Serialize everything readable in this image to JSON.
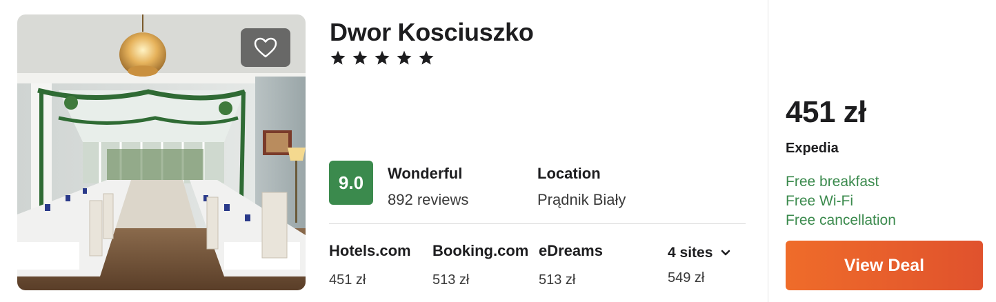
{
  "hotel": {
    "name": "Dwor Kosciuszko",
    "stars": 5
  },
  "rating": {
    "score": "9.0",
    "label": "Wonderful",
    "reviews": "892 reviews",
    "badge_color": "#3b8a4d"
  },
  "location": {
    "label": "Location",
    "value": "Prądnik Biały"
  },
  "sites": [
    {
      "name": "Hotels.com",
      "price": "451 zł"
    },
    {
      "name": "Booking.com",
      "price": "513 zł"
    },
    {
      "name": "eDreams",
      "price": "513 zł"
    }
  ],
  "more_sites": {
    "label": "4 sites",
    "price": "549 zł",
    "icon": "chevron-down-icon"
  },
  "deal": {
    "price": "451 zł",
    "provider": "Expedia",
    "perks": [
      "Free breakfast",
      "Free Wi-Fi",
      "Free cancellation"
    ],
    "button_label": "View Deal",
    "accent_color": "#e85d2b",
    "perk_color": "#3b8a4d"
  },
  "favorite": {
    "icon": "heart-icon"
  }
}
